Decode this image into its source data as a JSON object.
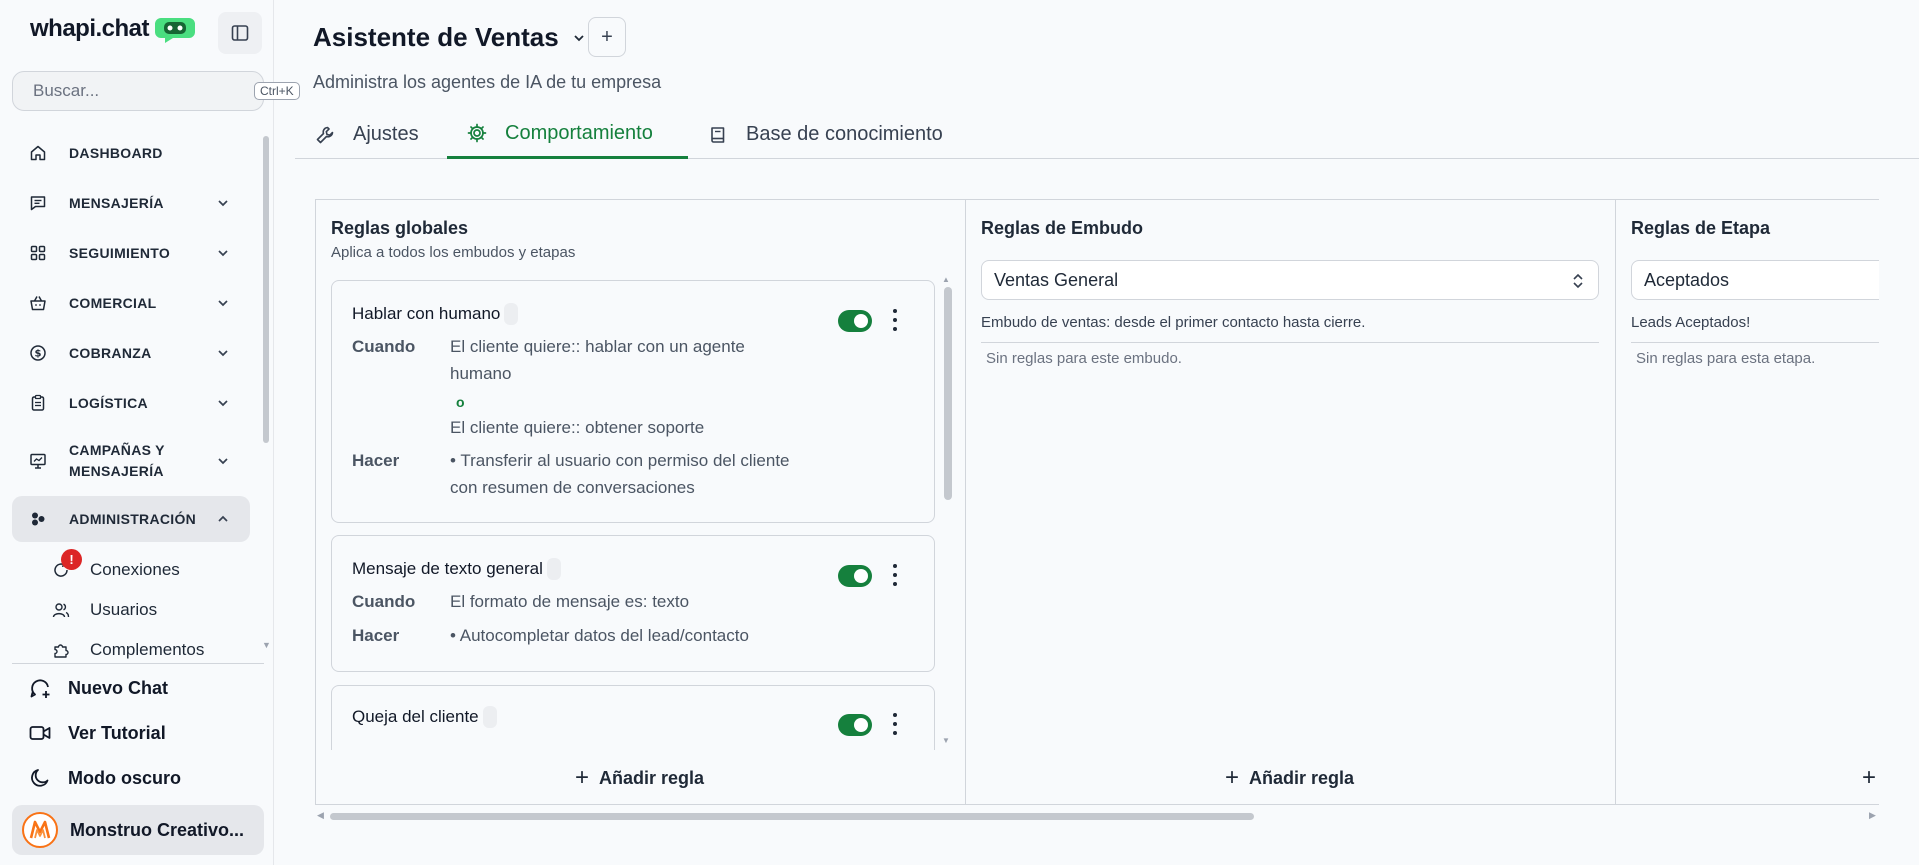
{
  "sidebar": {
    "logo": "whapi.chat",
    "search_placeholder": "Buscar...",
    "search_shortcut": "Ctrl+K",
    "nav": [
      {
        "label": "DASHBOARD",
        "icon": "home-icon"
      },
      {
        "label": "MENSAJERÍA",
        "icon": "message-icon"
      },
      {
        "label": "SEGUIMIENTO",
        "icon": "grid-icon"
      },
      {
        "label": "COMERCIAL",
        "icon": "basket-icon"
      },
      {
        "label": "COBRANZA",
        "icon": "dollar-icon"
      },
      {
        "label": "LOGÍSTICA",
        "icon": "clipboard-icon"
      },
      {
        "label": "CAMPAÑAS Y MENSAJERÍA",
        "icon": "presentation-icon"
      },
      {
        "label": "ADMINISTRACIÓN",
        "icon": "admin-icon"
      }
    ],
    "sub_items": [
      {
        "label": "Conexiones",
        "badge": "!"
      },
      {
        "label": "Usuarios"
      },
      {
        "label": "Complementos"
      }
    ],
    "bottom": {
      "new_chat": "Nuevo Chat",
      "tutorial": "Ver Tutorial",
      "dark_mode": "Modo oscuro",
      "user_name": "Monstruo Creativo..."
    }
  },
  "header": {
    "title": "Asistente de Ventas",
    "add_label": "+",
    "subtitle": "Administra los agentes de IA de tu empresa"
  },
  "tabs": [
    {
      "label": "Ajustes"
    },
    {
      "label": "Comportamiento",
      "active": true
    },
    {
      "label": "Base de conocimiento"
    }
  ],
  "columns": {
    "global": {
      "title": "Reglas globales",
      "subtitle": "Aplica a todos los embudos y etapas",
      "rules": [
        {
          "name": "Hablar con humano",
          "when_label": "Cuando",
          "when_1": "El cliente quiere:: hablar con un agente humano",
          "or": "o",
          "when_2": "El cliente quiere:: obtener soporte",
          "do_label": "Hacer",
          "do": "• Transferir al usuario con permiso del cliente con resumen de conversaciones",
          "enabled": true
        },
        {
          "name": "Mensaje de texto general",
          "when_label": "Cuando",
          "when_1": "El formato de mensaje es: texto",
          "do_label": "Hacer",
          "do": "• Autocompletar datos del lead/contacto",
          "enabled": true
        },
        {
          "name": "Queja del cliente",
          "enabled": true
        }
      ],
      "add_rule": "Añadir regla"
    },
    "funnel": {
      "title": "Reglas de Embudo",
      "selected": "Ventas General",
      "description": "Embudo de ventas: desde el primer contacto hasta cierre.",
      "empty": "Sin reglas para este embudo.",
      "add_rule": "Añadir regla"
    },
    "stage": {
      "title": "Reglas de Etapa",
      "selected": "Aceptados",
      "description": "Leads Aceptados!",
      "empty": "Sin reglas para esta etapa."
    }
  },
  "colors": {
    "accent": "#15803d",
    "badge": "#dc2626"
  }
}
